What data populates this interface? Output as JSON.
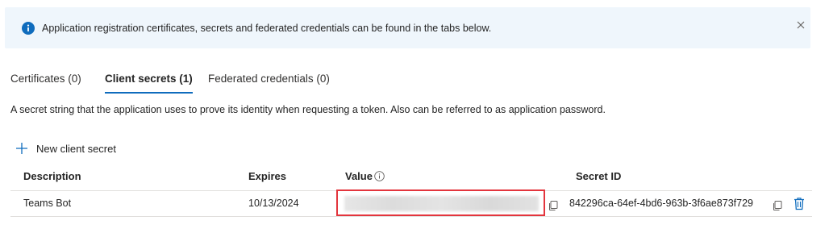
{
  "banner": {
    "message": "Application registration certificates, secrets and federated credentials can be found in the tabs below.",
    "info_icon": "info-circle-icon",
    "close_icon": "close-icon"
  },
  "tabs": [
    {
      "label": "Certificates (0)",
      "selected": false
    },
    {
      "label": "Client secrets (1)",
      "selected": true
    },
    {
      "label": "Federated credentials (0)",
      "selected": false
    }
  ],
  "description": "A secret string that the application uses to prove its identity when requesting a token. Also can be referred to as application password.",
  "toolbar": {
    "new_secret_label": "New client secret",
    "new_secret_icon": "plus-icon"
  },
  "table": {
    "columns": [
      "Description",
      "Expires",
      "Value",
      "Secret ID"
    ],
    "rows": [
      {
        "description": "Teams Bot",
        "expires": "10/13/2024",
        "value": "",
        "secret_id": "842296ca-64ef-4bd6-963b-3f6ae873f729"
      }
    ]
  },
  "colors": {
    "accent": "#0f6cbd",
    "banner_bg": "#eff6fc",
    "highlight_border": "#e3353d"
  }
}
